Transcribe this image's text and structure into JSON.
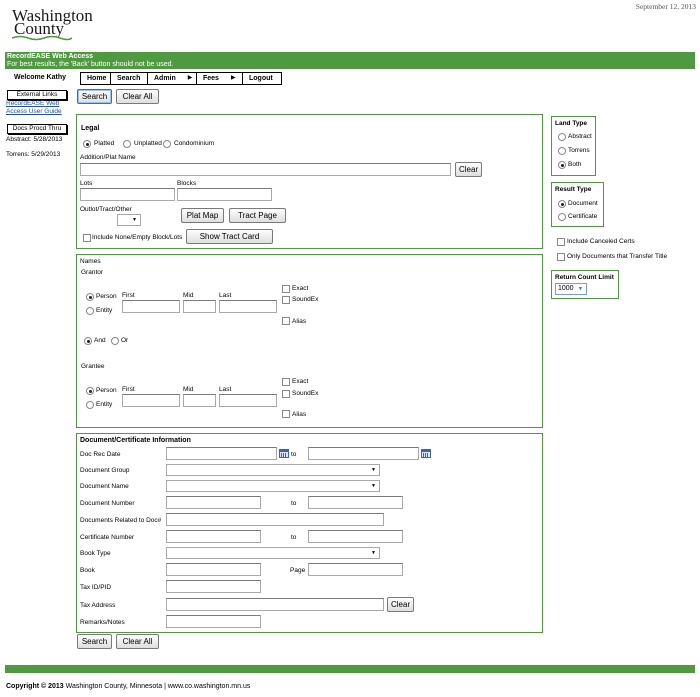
{
  "header": {
    "logo_line1": "Washington",
    "logo_line2": "County",
    "date": "September 12, 2013",
    "banner_title": "RecordEASE Web Access",
    "banner_note": "For best results, the 'Back' button should not be used."
  },
  "nav": {
    "welcome": "Welcome  Kathy",
    "items": [
      {
        "label": "Home"
      },
      {
        "label": "Search"
      },
      {
        "label": "Admin",
        "arrow": "▶"
      },
      {
        "label": "Fees",
        "arrow": "▶"
      },
      {
        "label": "Logout"
      }
    ]
  },
  "actions": {
    "search": "Search",
    "clear_all": "Clear All"
  },
  "sidebar": {
    "external_links": "External Links",
    "user_guide_link": "RecordEASE Web Access User Guide",
    "docs_procd": "Docs Procd Thru",
    "abstract": "Abstract: 5/28/2013",
    "torrens": "Torrens: 5/29/2013"
  },
  "legal": {
    "title": "Legal",
    "radios": [
      "Platted",
      "Unplatted",
      "Condominium"
    ],
    "selected_radio": "Platted",
    "addition_label": "Addition/Plat Name",
    "clear": "Clear",
    "lots": "Lots",
    "blocks": "Blocks",
    "outlot": "Outlot/Tract/Other",
    "plat_map": "Plat Map",
    "tract_page": "Tract Page",
    "include_none": "Include None/Empty Block/Lots",
    "show_tract_card": "Show Tract Card"
  },
  "names": {
    "title": "Names",
    "grantor": "Grantor",
    "grantee": "Grantee",
    "person": "Person",
    "entity": "Entity",
    "first": "First",
    "mid": "Mid",
    "last": "Last",
    "exact": "Exact",
    "soundex": "SoundEx",
    "alias": "Alias",
    "and": "And",
    "or": "Or"
  },
  "doc": {
    "title": "Document/Certificate Information",
    "doc_rec_date": "Doc Rec Date",
    "to": "to",
    "document_group": "Document Group",
    "document_name": "Document Name",
    "document_number": "Document Number",
    "documents_related": "Documents Related to Doc#",
    "certificate_number": "Certificate Number",
    "book_type": "Book Type",
    "book": "Book",
    "page": "Page",
    "tax_id": "Tax ID/PID",
    "tax_address": "Tax Address",
    "clear": "Clear",
    "remarks": "Remarks/Notes"
  },
  "land_type": {
    "title": "Land Type",
    "options": [
      "Abstract",
      "Torrens",
      "Both"
    ],
    "selected": "Both"
  },
  "result_type": {
    "title": "Result Type",
    "options": [
      "Document",
      "Certificate"
    ],
    "selected": "Document"
  },
  "options": {
    "include_canceled": "Include Canceled Certs",
    "only_transfer": "Only Documents that Transfer Title"
  },
  "return_count": {
    "title": "Return Count Limit",
    "value": "1000"
  },
  "footer": {
    "copyright": "Copyright © 2013",
    "org": "Washington County, Minnesota",
    "url": "www.co.washington.mn.us"
  },
  "colors": {
    "accent": "#4f9a41",
    "link": "#1e4fb4"
  }
}
